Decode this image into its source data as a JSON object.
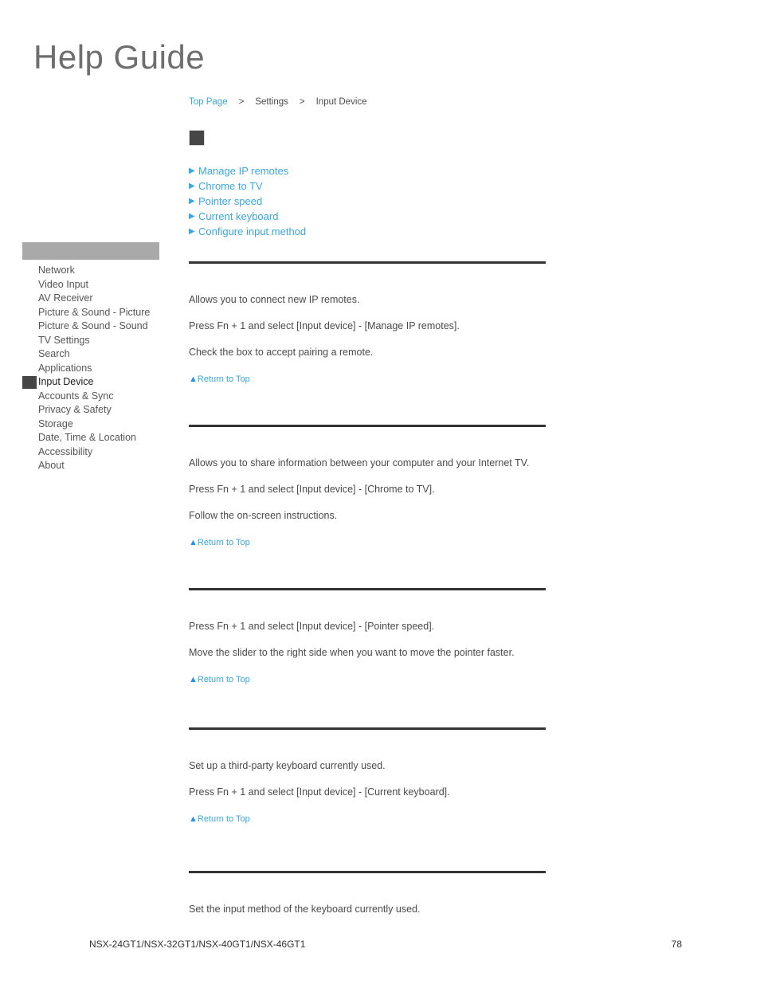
{
  "masthead": {
    "title": "Help Guide"
  },
  "breadcrumb": {
    "separator": ">",
    "items": [
      {
        "label": "Top Page",
        "link": true
      },
      {
        "label": "Settings",
        "link": false
      },
      {
        "label": "Input Device",
        "link": false
      }
    ]
  },
  "page_header": {
    "image_placeholder_name": "input-device-heading-image"
  },
  "jumplist": {
    "arrow_glyph": "▶",
    "items": [
      {
        "label": "Manage IP remotes"
      },
      {
        "label": "Chrome to TV"
      },
      {
        "label": "Pointer speed"
      },
      {
        "label": "Current keyboard"
      },
      {
        "label": "Configure input method"
      }
    ]
  },
  "sidebar": {
    "header_label": "",
    "current": "Input Device",
    "items": [
      {
        "label": "Network"
      },
      {
        "label": "Video Input"
      },
      {
        "label": "AV Receiver"
      },
      {
        "label": "Picture & Sound - Picture"
      },
      {
        "label": "Picture & Sound - Sound"
      },
      {
        "label": "TV Settings"
      },
      {
        "label": "Search"
      },
      {
        "label": "Applications"
      },
      {
        "label": "Input Device"
      },
      {
        "label": "Accounts & Sync"
      },
      {
        "label": "Privacy & Safety"
      },
      {
        "label": "Storage"
      },
      {
        "label": "Date, Time & Location"
      },
      {
        "label": "Accessibility"
      },
      {
        "label": "About"
      }
    ]
  },
  "sections": [
    {
      "id": "manage-ip-remotes",
      "paragraphs": [
        "Allows you to connect new IP remotes.",
        "Press Fn + 1 and select [Input device] - [Manage IP remotes].",
        "Check the box to accept pairing a remote."
      ],
      "return_to_top": "Return to Top"
    },
    {
      "id": "chrome-to-tv",
      "paragraphs": [
        "Allows you to share information between your computer and your Internet TV.",
        "Press Fn + 1 and select [Input device] - [Chrome to TV].",
        "Follow the on-screen instructions."
      ],
      "return_to_top": "Return to Top"
    },
    {
      "id": "pointer-speed",
      "paragraphs": [
        "Press Fn + 1 and select [Input device] - [Pointer speed].",
        "Move the slider to the right side when you want to move the pointer faster."
      ],
      "return_to_top": "Return to Top"
    },
    {
      "id": "current-keyboard",
      "paragraphs": [
        "Set up a third-party keyboard currently used.",
        "Press Fn + 1 and select [Input device] - [Current keyboard]."
      ],
      "return_to_top": "Return to Top"
    },
    {
      "id": "configure-input-method",
      "paragraphs": [
        "Set the input method of the keyboard currently used."
      ],
      "return_to_top": ""
    }
  ],
  "footer": {
    "model": "NSX-24GT1/NSX-32GT1/NSX-40GT1/NSX-46GT1",
    "page_number": "78"
  },
  "colors": {
    "link_blue": "#3aa8de",
    "arrow_blue": "#2196e8",
    "text_gray": "#4a4a4a",
    "rule_dark": "#333333",
    "sidebar_header_gray": "#a9a9a9",
    "marker_dark": "#464646",
    "masthead_gray": "#6e6e6e"
  }
}
